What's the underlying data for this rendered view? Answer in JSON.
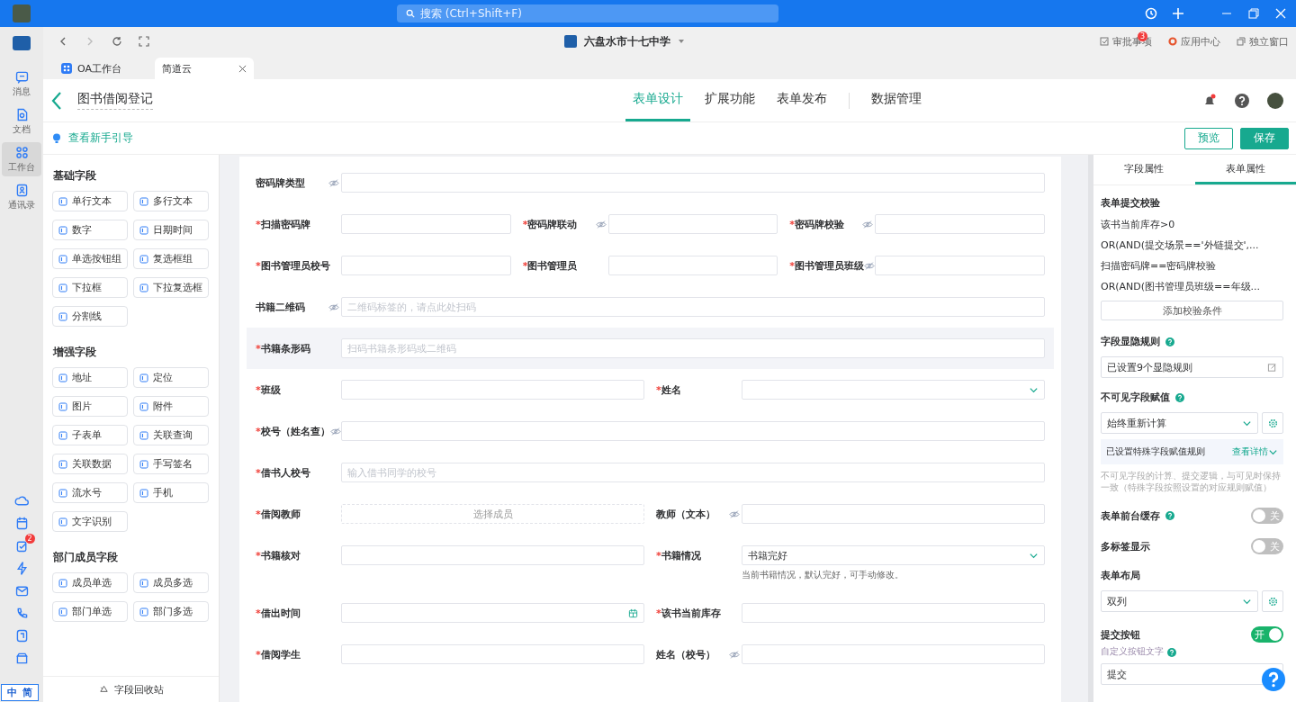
{
  "title_bar": {
    "search": {
      "placeholder": "搜索 (Ctrl+Shift+F)"
    }
  },
  "rail": {
    "items": [
      {
        "label": "消息",
        "kind": "chat",
        "selected": false
      },
      {
        "label": "文档",
        "kind": "doc",
        "selected": false
      },
      {
        "label": "工作台",
        "kind": "grid",
        "selected": true
      },
      {
        "label": "通讯录",
        "kind": "contact",
        "selected": false
      }
    ],
    "bottom_icons": [
      {
        "kind": "cloud"
      },
      {
        "kind": "calendar"
      },
      {
        "kind": "task",
        "badge": "2"
      },
      {
        "kind": "bolt"
      },
      {
        "kind": "mail"
      },
      {
        "kind": "phone"
      },
      {
        "kind": "note"
      },
      {
        "kind": "box"
      }
    ]
  },
  "ime": {
    "items": [
      "中",
      "简"
    ]
  },
  "toolbar": {
    "org": "六盘水市十七中学",
    "links": [
      {
        "label": "审批事项",
        "kind": "approve",
        "badge": "3"
      },
      {
        "label": "应用中心",
        "kind": "apps"
      },
      {
        "label": "独立窗口",
        "kind": "window"
      }
    ]
  },
  "tabs": [
    {
      "label": "OA工作台",
      "selected": false
    },
    {
      "label": "简道云",
      "selected": true
    }
  ],
  "header": {
    "title": "图书借阅登记",
    "tabs": [
      {
        "label": "表单设计",
        "selected": true,
        "separated": false
      },
      {
        "label": "扩展功能",
        "selected": false,
        "separated": false
      },
      {
        "label": "表单发布",
        "selected": false,
        "separated": false
      },
      {
        "label": "数据管理",
        "selected": false,
        "separated": true
      }
    ]
  },
  "guide_link": "查看新手引导",
  "buttons": [
    {
      "label": "预览",
      "kind": "outline"
    },
    {
      "label": "保存",
      "kind": "primary"
    }
  ],
  "palette": {
    "sections": [
      {
        "title": "基础字段",
        "items": [
          "单行文本",
          "多行文本",
          "数字",
          "日期时间",
          "单选按钮组",
          "复选框组",
          "下拉框",
          "下拉复选框",
          "分割线"
        ]
      },
      {
        "title": "增强字段",
        "items": [
          "地址",
          "定位",
          "图片",
          "附件",
          "子表单",
          "关联查询",
          "关联数据",
          "手写签名",
          "流水号",
          "手机",
          "文字识别"
        ]
      },
      {
        "title": "部门成员字段",
        "items": [
          "成员单选",
          "成员多选",
          "部门单选",
          "部门多选"
        ]
      }
    ],
    "recycle": "字段回收站"
  },
  "form": {
    "rows": [
      {
        "selected": false,
        "fields": [
          {
            "label": "密码牌类型",
            "hidden": true,
            "kind": "text"
          }
        ]
      },
      {
        "selected": false,
        "fields": [
          {
            "mark": "*",
            "label": "扫描密码牌",
            "hidden": false,
            "kind": "text"
          },
          {
            "mark": "*",
            "label": "密码牌联动",
            "hidden": true,
            "kind": "text"
          },
          {
            "mark": "*",
            "label": "密码牌校验",
            "hidden": true,
            "kind": "text"
          }
        ]
      },
      {
        "selected": false,
        "fields": [
          {
            "mark": "*",
            "label": "图书管理员校号",
            "hidden": false,
            "kind": "text"
          },
          {
            "mark": "*",
            "label": "图书管理员",
            "hidden": false,
            "kind": "text"
          },
          {
            "mark": "*",
            "label": "图书管理员班级",
            "hidden": true,
            "kind": "text"
          }
        ]
      },
      {
        "selected": false,
        "fields": [
          {
            "label": "书籍二维码",
            "hidden": true,
            "kind": "text",
            "placeholder": "二维码标签的，请点此处扫码"
          }
        ]
      },
      {
        "selected": true,
        "fields": [
          {
            "mark": "*",
            "label": "书籍条形码",
            "hidden": false,
            "kind": "text",
            "placeholder": "扫码书籍条形码或二维码"
          }
        ]
      },
      {
        "selected": false,
        "fields": [
          {
            "mark": "*",
            "label": "班级",
            "hidden": false,
            "kind": "text"
          },
          {
            "mark": "*",
            "label": "姓名",
            "hidden": false,
            "kind": "select"
          }
        ]
      },
      {
        "selected": false,
        "fields": [
          {
            "mark": "*",
            "label": "校号（姓名查）",
            "hidden": true,
            "kind": "text"
          }
        ]
      },
      {
        "selected": false,
        "fields": [
          {
            "mark": "*",
            "label": "借书人校号",
            "hidden": false,
            "kind": "text",
            "placeholder": "输入借书同学的校号"
          }
        ]
      },
      {
        "selected": false,
        "fields": [
          {
            "mark": "*",
            "label": "借阅教师",
            "hidden": false,
            "kind": "member",
            "placeholder": "选择成员"
          },
          {
            "label": "教师（文本）",
            "hidden": true,
            "kind": "text"
          }
        ]
      },
      {
        "selected": false,
        "fields": [
          {
            "mark": "*",
            "label": "书籍核对",
            "hidden": false,
            "kind": "text"
          },
          {
            "mark": "*",
            "label": "书籍情况",
            "hidden": false,
            "kind": "select",
            "value": "书籍完好",
            "hint": "当前书籍情况，默认完好，可手动修改。"
          }
        ]
      },
      {
        "selected": false,
        "fields": [
          {
            "mark": "*",
            "label": "借出时间",
            "hidden": false,
            "kind": "date"
          },
          {
            "mark": "*",
            "label": "该书当前库存",
            "hidden": false,
            "kind": "text"
          }
        ]
      },
      {
        "selected": false,
        "fields": [
          {
            "mark": "*",
            "label": "借阅学生",
            "hidden": false,
            "kind": "text"
          },
          {
            "label": "姓名（校号）",
            "hidden": true,
            "kind": "text"
          }
        ]
      }
    ]
  },
  "properties": {
    "tabs": [
      {
        "label": "字段属性",
        "selected": false
      },
      {
        "label": "表单属性",
        "selected": true
      }
    ],
    "validation": {
      "title": "表单提交校验",
      "rules": [
        "该书当前库存>0",
        "OR(AND(提交场景=='外链提交',...",
        "扫描密码牌==密码牌校验",
        "OR(AND(图书管理员班级==年级..."
      ],
      "add_button": "添加校验条件"
    },
    "visibility": {
      "title": "字段显隐规则",
      "value": "已设置9个显隐规则"
    },
    "invisible": {
      "title": "不可见字段赋值",
      "value": "始终重新计算",
      "info": "已设置特殊字段赋值规则",
      "info_link": "查看详情",
      "note": "不可见字段的计算、提交逻辑，与可见时保持一致（特殊字段按照设置的对应规则赋值）"
    },
    "toggles": [
      {
        "label": "表单前台缓存",
        "help": true,
        "on": false,
        "text": "关"
      },
      {
        "label": "多标签显示",
        "help": false,
        "on": false,
        "text": "关"
      }
    ],
    "layout": {
      "title": "表单布局",
      "value": "双列"
    },
    "submit": {
      "title": "提交按钮",
      "on": true,
      "text": "开",
      "sub_label": "自定义按钮文字",
      "value": "提交"
    }
  }
}
